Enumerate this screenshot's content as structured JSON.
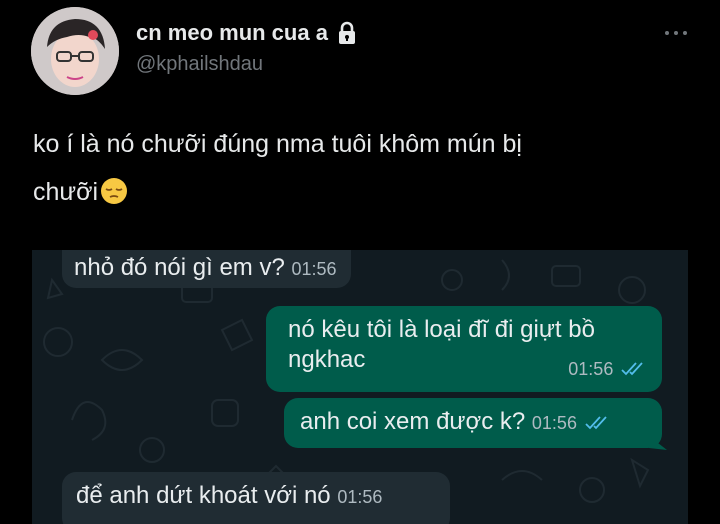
{
  "user": {
    "display_name": "cn meo mun cua a",
    "handle": "@kphailshdau"
  },
  "tweet": {
    "text_line1": "ko í là nó chưỡi đúng nma tuôi khôm mún bị",
    "text_line2": "chưỡi"
  },
  "chat": {
    "messages": [
      {
        "direction": "incoming",
        "text": "nhỏ đó nói gì em v?",
        "time": "01:56"
      },
      {
        "direction": "outgoing",
        "text_line1": "nó kêu tôi là loại đĩ đi giựt bồ",
        "text_line2": "ngkhac",
        "time": "01:56",
        "status": "read"
      },
      {
        "direction": "outgoing",
        "text": "anh coi xem được k?",
        "time": "01:56",
        "status": "read"
      },
      {
        "direction": "incoming",
        "text": "để anh dứt khoát với nó",
        "time": "01:56"
      }
    ]
  },
  "colors": {
    "background": "#000000",
    "chat_background": "#111b21",
    "incoming_bubble": "#202c33",
    "outgoing_bubble": "#005c4b",
    "read_ticks": "#53bdeb"
  },
  "icons": {
    "lock": "lock-icon",
    "more": "more-dots-icon",
    "emoji": "pensive-face-emoji",
    "ticks": "double-check-icon"
  }
}
